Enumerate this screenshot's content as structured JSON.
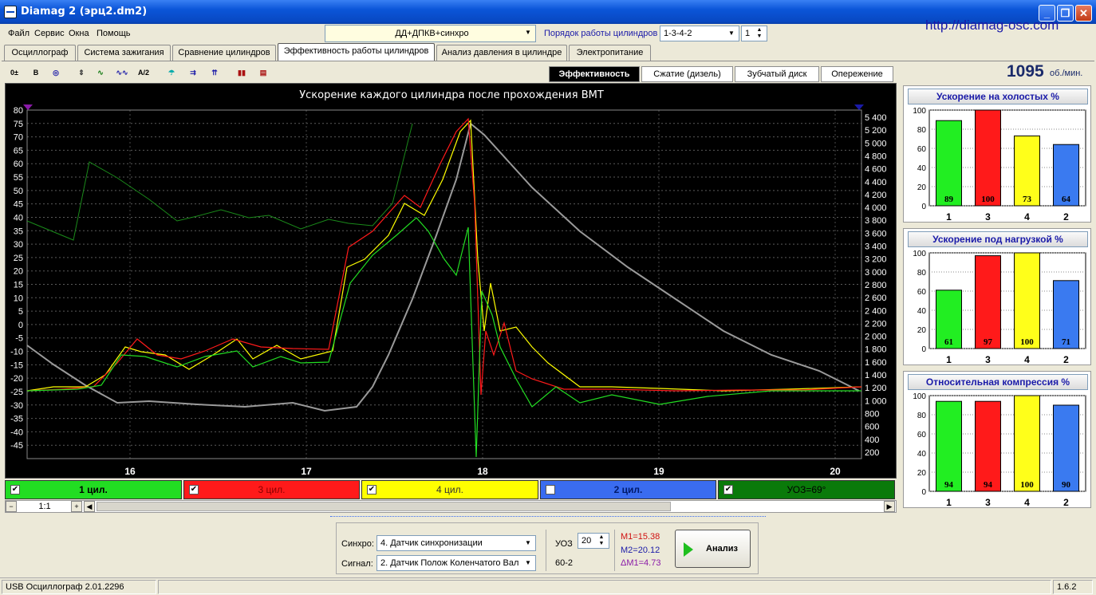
{
  "window": {
    "title": "Diamag 2 (эрц2.dm2)",
    "url": "http://diamag-osc.com"
  },
  "menu": [
    "Файл",
    "Сервис",
    "Окна",
    "Помощь"
  ],
  "mode_combo": "ДД+ДПКВ+синхро",
  "order": {
    "label": "Порядок работы цилиндров",
    "value": "1-3-4-2",
    "cylinder": "1"
  },
  "tabs": [
    "Осциллограф",
    "Система зажигания",
    "Сравнение цилиндров",
    "Эффективность работы цилиндров",
    "Анализ давления в цилиндре",
    "Электропитание"
  ],
  "active_tab": 3,
  "toolbar_icons": [
    "zero-scale-icon",
    "bold-icon",
    "rpm-icon",
    "scale-icon",
    "curve-icon",
    "vvti-icon",
    "algorithm-icon",
    "sensor-icon",
    "cyl-order-icon",
    "filter-icon",
    "bars-icon",
    "log-icon"
  ],
  "subtabs": [
    "Эффективность",
    "Сжатие (дизель)",
    "Зубчатый диск",
    "Опережение"
  ],
  "rpm": {
    "value": "1095",
    "unit": "об./мин."
  },
  "chart": {
    "title": "Ускорение каждого цилиндра после прохождения ВМТ",
    "left_ticks": [
      "80",
      "75",
      "70",
      "65",
      "60",
      "55",
      "50",
      "45",
      "40",
      "35",
      "30",
      "25",
      "20",
      "15",
      "10",
      "5",
      "0",
      "-5",
      "-10",
      "-15",
      "-20",
      "-25",
      "-30",
      "-35",
      "-40",
      "-45"
    ],
    "right_ticks": [
      "5 400",
      "5 200",
      "5 000",
      "4 800",
      "4 600",
      "4 400",
      "4 200",
      "4 000",
      "3 800",
      "3 600",
      "3 400",
      "3 200",
      "3 000",
      "2 800",
      "2 600",
      "2 400",
      "2 200",
      "2 000",
      "1 800",
      "1 600",
      "1 400",
      "1 200",
      "1 000",
      "800",
      "600",
      "400",
      "200"
    ],
    "x_ticks": [
      "16",
      "17",
      "18",
      "19",
      "20"
    ]
  },
  "channels": [
    {
      "label": "1 цил.",
      "checked": true,
      "color": "#22dd22",
      "text_color": "#000"
    },
    {
      "label": "3 цил.",
      "checked": true,
      "color": "#ff1a1a",
      "text_color": "#8a0000"
    },
    {
      "label": "4 цил.",
      "checked": true,
      "color": "#ffff00",
      "text_color": "#333"
    },
    {
      "label": "2 цил.",
      "checked": false,
      "color": "#3a6cf0",
      "text_color": "#001a6a"
    },
    {
      "label": "УОЗ=69°",
      "checked": true,
      "color": "#0a7a0a",
      "text_color": "#000"
    }
  ],
  "zoom_label": "1:1",
  "panels": [
    {
      "title": "Ускорение на холостых %",
      "values": [
        89,
        100,
        73,
        64
      ]
    },
    {
      "title": "Ускорение под нагрузкой %",
      "values": [
        61,
        97,
        100,
        71
      ]
    },
    {
      "title": "Относительная компрессия %",
      "values": [
        94,
        94,
        100,
        90
      ]
    }
  ],
  "panel_ticks": [
    "100",
    "80",
    "60",
    "40",
    "20",
    "0"
  ],
  "panel_categories": [
    "1",
    "3",
    "4",
    "2"
  ],
  "panel_colors": [
    "#22ee22",
    "#ff1a1a",
    "#ffff1a",
    "#3a7af0"
  ],
  "bottom": {
    "sync_label": "Синхро:",
    "sync_value": "4. Датчик синхронизации",
    "signal_label": "Сигнал:",
    "signal_value": "2. Датчик Полож Коленчатого Вал",
    "uoz_label": "УОЗ",
    "uoz_value": "20",
    "teeth": "60-2",
    "m1": "M1=15.38",
    "m2": "M2=20.12",
    "dm1": "ΔM1=4.73",
    "analyze": "Анализ"
  },
  "status": {
    "left": "USB Осциллограф  2.01.2296",
    "version": "1.6.2"
  }
}
